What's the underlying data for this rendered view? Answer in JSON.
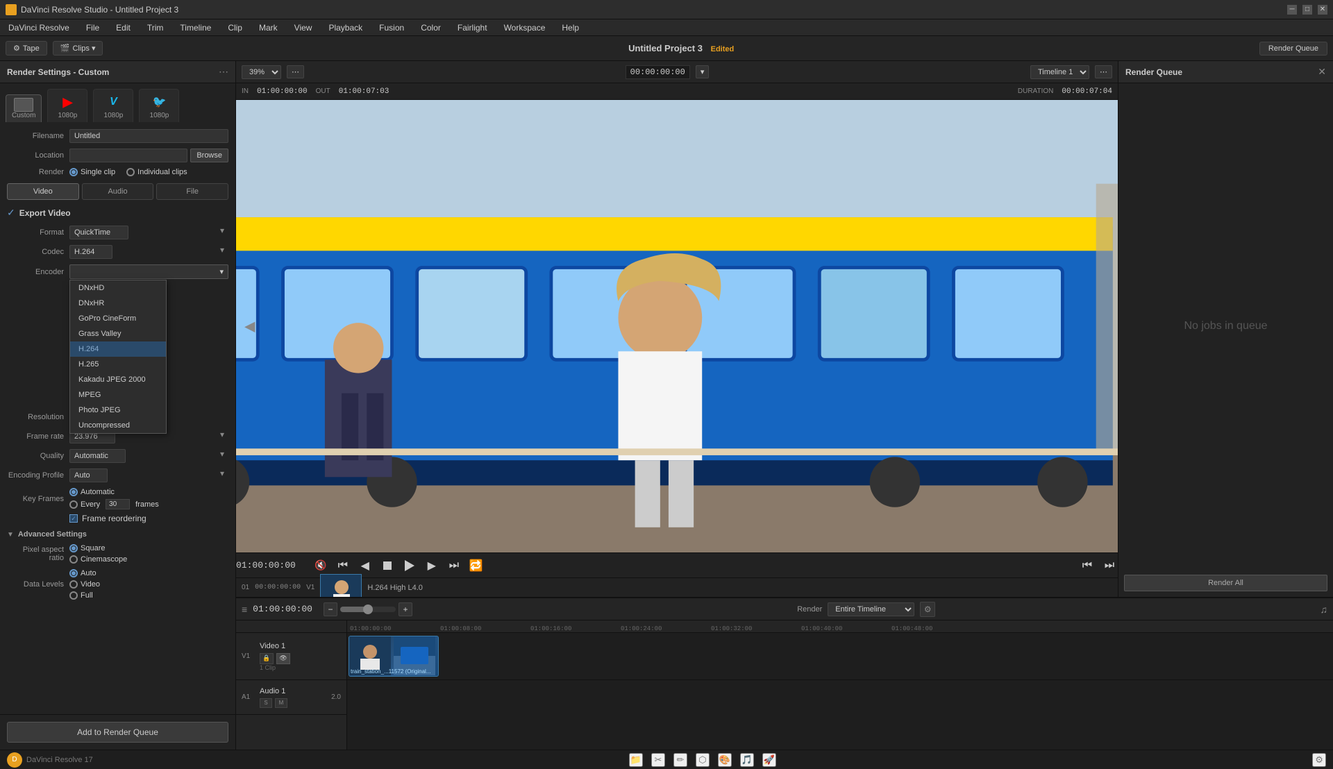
{
  "window": {
    "title": "DaVinci Resolve Studio - Untitled Project 3"
  },
  "menu": {
    "items": [
      "DaVinci Resolve",
      "File",
      "Edit",
      "Trim",
      "Timeline",
      "Clip",
      "Mark",
      "View",
      "Playback",
      "Fusion",
      "Color",
      "Fairlight",
      "Workspace",
      "Help"
    ]
  },
  "toolbar": {
    "project_title": "Untitled Project 3",
    "edited_label": "Edited",
    "render_queue_label": "Render Queue",
    "timeline_select": "Timeline 1",
    "timecode": "00:00:00:00"
  },
  "render_settings": {
    "panel_title": "Render Settings - Custom",
    "format_tabs": [
      {
        "label": "Custom",
        "sub": ""
      },
      {
        "label": "1080p",
        "sub": "YouTube"
      },
      {
        "label": "1080p",
        "sub": "Vimeo"
      },
      {
        "label": "1080p",
        "sub": "Twitter"
      }
    ],
    "filename_label": "Filename",
    "filename_value": "Untitled",
    "location_label": "Location",
    "location_value": "",
    "browse_label": "Browse",
    "render_label": "Render",
    "single_clip_label": "Single clip",
    "individual_clips_label": "Individual clips",
    "tabs": {
      "video_label": "Video",
      "audio_label": "Audio",
      "file_label": "File"
    },
    "export_video_label": "Export Video",
    "format_label": "Format",
    "format_value": "QuickTime",
    "codec_label": "Codec",
    "codec_value": "H.264",
    "encoder_label": "Encoder",
    "dropdown_items": [
      {
        "label": "DNxHD",
        "selected": false
      },
      {
        "label": "DNxHR",
        "selected": false
      },
      {
        "label": "GoPro CineForm",
        "selected": false
      },
      {
        "label": "Grass Valley",
        "selected": false
      },
      {
        "label": "H.264",
        "selected": true
      },
      {
        "label": "H.265",
        "selected": false
      },
      {
        "label": "Kakadu JPEG 2000",
        "selected": false
      },
      {
        "label": "MPEG",
        "selected": false
      },
      {
        "label": "Photo JPEG",
        "selected": false
      },
      {
        "label": "Uncompressed",
        "selected": false
      }
    ],
    "resolution_label": "Resolution",
    "framerate_label": "Frame rate",
    "quality_label": "Quality",
    "encoding_profile_label": "Encoding Profile",
    "encoding_profile_value": "Auto",
    "key_frames_label": "Key Frames",
    "automatic_label": "Automatic",
    "every_label": "Every",
    "every_value": "30",
    "frames_label": "frames",
    "frame_reorder_label": "Frame reordering",
    "advanced_settings_label": "Advanced Settings",
    "pixel_aspect_ratio_label": "Pixel aspect ratio",
    "square_label": "Square",
    "cinemascope_label": "Cinemascope",
    "data_levels_label": "Data Levels",
    "auto_label": "Auto",
    "video_label2": "Video",
    "full_label": "Full",
    "add_queue_label": "Add to Render Queue"
  },
  "preview": {
    "zoom": "39%",
    "in_label": "IN",
    "in_value": "01:00:00:00",
    "out_label": "OUT",
    "out_value": "01:00:07:03",
    "duration_label": "DURATION",
    "duration_value": "00:00:07:04",
    "timecode": "01:00:00:00",
    "clip_label": "H.264 High L4.0"
  },
  "render_queue": {
    "title": "Render Queue",
    "empty_message": "No jobs in queue",
    "render_all_label": "Render All"
  },
  "timeline": {
    "timecode": "01:00:00:00",
    "render_label": "Render",
    "entire_timeline_label": "Entire Timeline",
    "tracks": [
      {
        "id": "V1",
        "name": "Video 1",
        "type": "video",
        "clip_label": "1 Clip"
      },
      {
        "id": "A1",
        "name": "Audio 1",
        "type": "audio"
      }
    ],
    "ruler_marks": [
      "01:00:00:00",
      "01:00:08:00",
      "01:00:16:00",
      "01:00:24:00",
      "01:00:32:00",
      "01:00:40:00",
      "01:00:48:00"
    ],
    "clip_name": "train_station_...11572 (Original...",
    "clip_timecode": "00:00:00:00"
  },
  "footer": {
    "logo": "DaVinci Resolve 17",
    "icons": [
      "media",
      "cut",
      "edit",
      "fusion",
      "color",
      "fairlight",
      "deliver",
      "settings"
    ]
  }
}
